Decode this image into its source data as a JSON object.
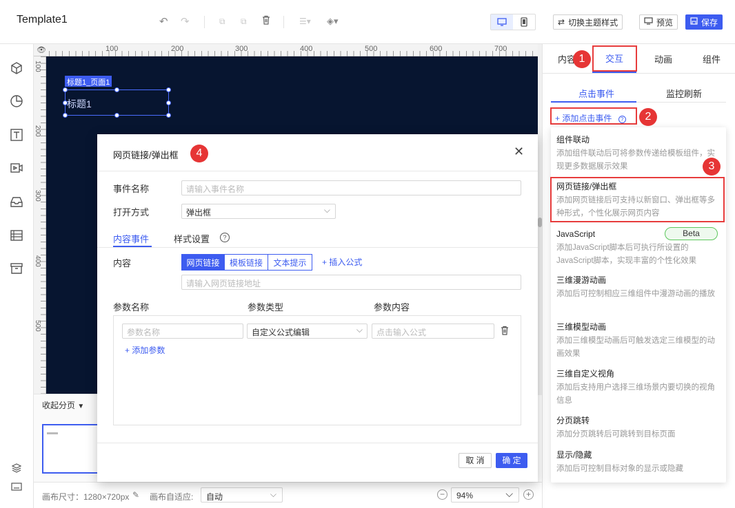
{
  "app": {
    "title": "Template1"
  },
  "toolbar": {
    "theme_label": "切换主题样式",
    "preview_label": "预览",
    "save_label": "保存"
  },
  "ruler": {
    "top_ticks": [
      "100",
      "200",
      "300",
      "400",
      "500",
      "600",
      "700"
    ],
    "left_ticks": [
      "100",
      "200",
      "300",
      "400",
      "500"
    ]
  },
  "canvas": {
    "component_tag": "标题1_页面1",
    "component_text": "标题1",
    "bg_color": "#071530"
  },
  "pages": {
    "collapse_label": "收起分页"
  },
  "statusbar": {
    "size_label": "画布尺寸：1280×720px",
    "adapt_label": "画布自适应:",
    "adapt_value": "自动",
    "zoom_value": "94%"
  },
  "right_panel": {
    "tabs": [
      "内容",
      "交互",
      "动画",
      "组件"
    ],
    "subtabs": [
      "点击事件",
      "监控刷新"
    ],
    "add_event_label": "添加点击事件"
  },
  "dropdown": {
    "items": [
      {
        "title": "组件联动",
        "desc": "添加组件联动后可将参数传递给模板组件，实现更多数据展示效果"
      },
      {
        "title": "网页链接/弹出框",
        "desc": "添加网页链接后可支持以新窗口、弹出框等多种形式，个性化展示网页内容"
      },
      {
        "title": "JavaScript",
        "desc": "添加JavaScript脚本后可执行所设置的JavaScript脚本，实现丰富的个性化效果",
        "badge": "Beta"
      },
      {
        "title": "三维漫游动画",
        "desc": "添加后可控制相应三维组件中漫游动画的播放"
      },
      {
        "title": "三维模型动画",
        "desc": "添加三维模型动画后可触发选定三维模型的动画效果"
      },
      {
        "title": "三维自定义视角",
        "desc": "添加后支持用户选择三维场景内要切换的视角信息"
      },
      {
        "title": "分页跳转",
        "desc": "添加分页跳转后可跳转到目标页面"
      },
      {
        "title": "显示/隐藏",
        "desc": "添加后可控制目标对象的显示或隐藏"
      }
    ]
  },
  "modal": {
    "title": "网页链接/弹出框",
    "event_name_label": "事件名称",
    "event_name_placeholder": "请输入事件名称",
    "open_mode_label": "打开方式",
    "open_mode_value": "弹出框",
    "tabs": [
      "内容事件",
      "样式设置"
    ],
    "content_label": "内容",
    "content_types": [
      "网页链接",
      "模板链接",
      "文本提示"
    ],
    "insert_formula": "插入公式",
    "url_placeholder": "请输入网页链接地址",
    "param_headers": [
      "参数名称",
      "参数类型",
      "参数内容"
    ],
    "param_name_placeholder": "参数名称",
    "param_type_value": "自定义公式编辑",
    "param_content_placeholder": "点击输入公式",
    "add_param": "添加参数",
    "cancel_label": "取 消",
    "ok_label": "确 定"
  },
  "markers": [
    "1",
    "2",
    "3",
    "4"
  ],
  "colors": {
    "accent": "#3d5cf0",
    "marker_red": "#e63535"
  }
}
